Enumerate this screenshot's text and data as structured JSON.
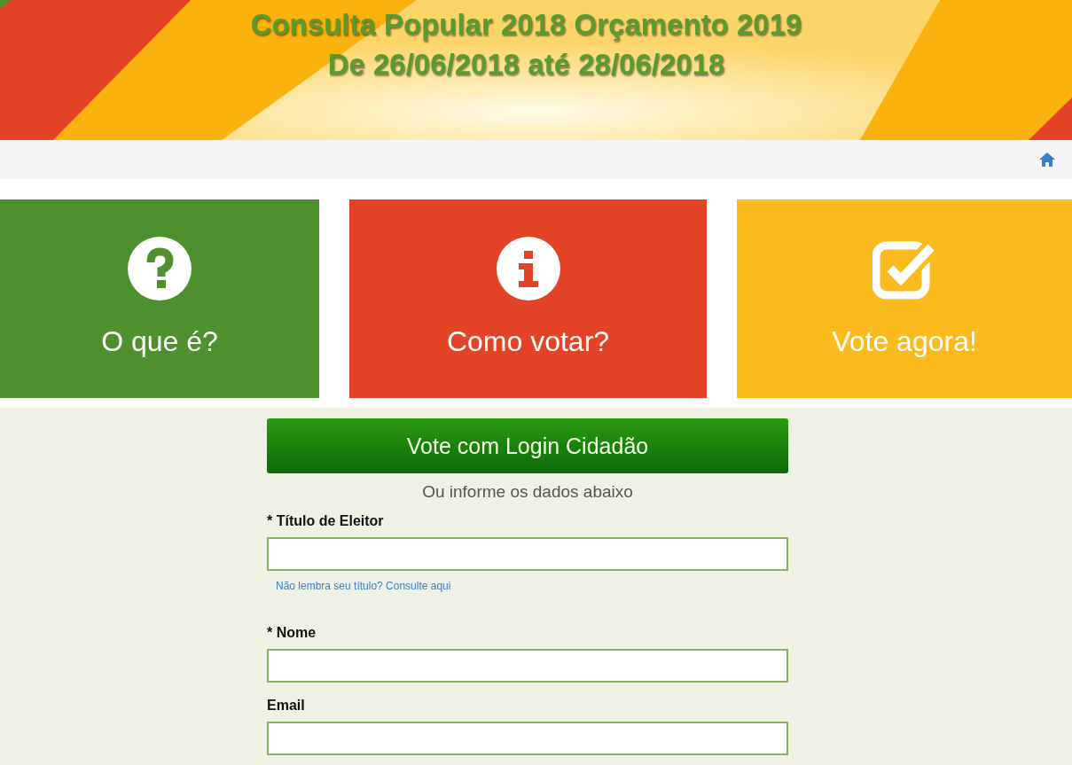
{
  "banner": {
    "title_lines": [
      "Consulta Popular 2018 Orçamento 2019",
      "De 26/06/2018 até 28/06/2018"
    ]
  },
  "tiles": [
    {
      "kind": "question",
      "label": "O que é?",
      "color": "#4e8f2e"
    },
    {
      "kind": "info",
      "label": "Como votar?",
      "color": "#e34427"
    },
    {
      "kind": "check",
      "label": "Vote agora!",
      "color": "#fbbb1f"
    }
  ],
  "login_button": "Vote com Login Cidadão",
  "divider_text": "Ou informe os dados abaixo",
  "fields": [
    {
      "label": "* Título de Eleitor",
      "help_link": "Não lembra seu título? Consulte aqui"
    },
    {
      "label": "* Nome"
    },
    {
      "label": "Email"
    }
  ]
}
